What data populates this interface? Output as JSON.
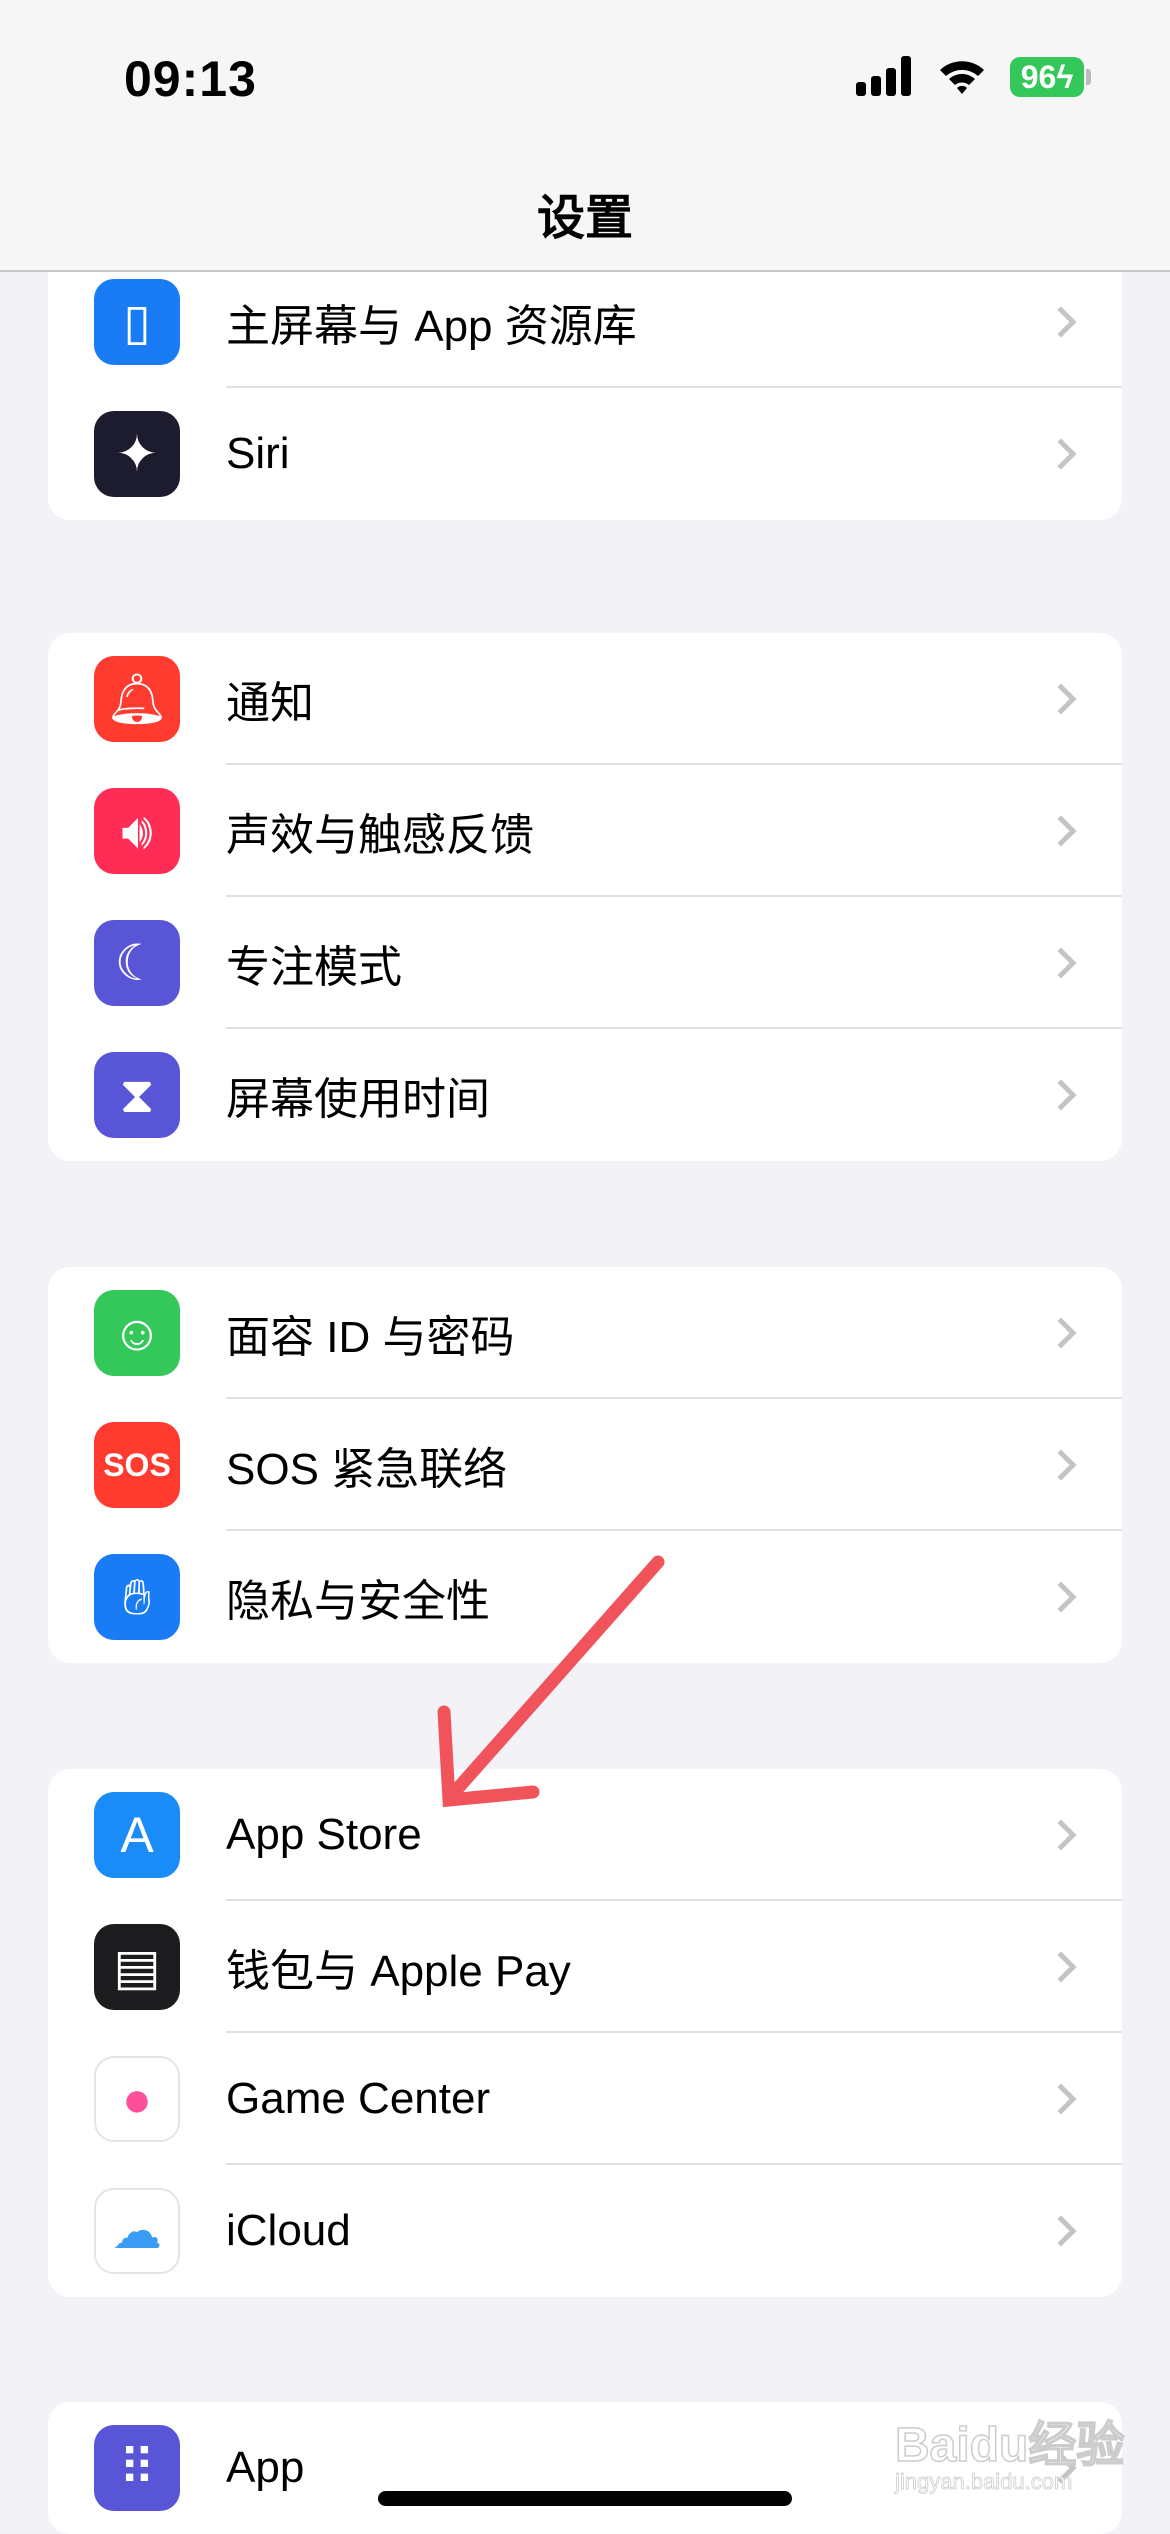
{
  "status_bar": {
    "time": "09:13",
    "battery": "96",
    "charging": true,
    "battery_color": "#34c759"
  },
  "header": {
    "title": "设置"
  },
  "groups": [
    {
      "items": [
        {
          "label": "主屏幕与 App 资源库",
          "icon": "home-screen-icon",
          "color": "#1a7cf5"
        },
        {
          "label": "Siri",
          "icon": "siri-icon",
          "color": "#1c1c2e"
        }
      ]
    },
    {
      "items": [
        {
          "label": "通知",
          "icon": "bell-icon",
          "color": "#ff3b30"
        },
        {
          "label": "声效与触感反馈",
          "icon": "speaker-icon",
          "color": "#ff2d55"
        },
        {
          "label": "专注模式",
          "icon": "moon-icon",
          "color": "#5856d6"
        },
        {
          "label": "屏幕使用时间",
          "icon": "hourglass-icon",
          "color": "#5856d6"
        }
      ]
    },
    {
      "items": [
        {
          "label": "面容 ID 与密码",
          "icon": "face-id-icon",
          "color": "#34c759"
        },
        {
          "label": "SOS 紧急联络",
          "icon": "sos-icon",
          "color": "#ff3b30",
          "icon_text": "SOS"
        },
        {
          "label": "隐私与安全性",
          "icon": "hand-icon",
          "color": "#1a7cf5"
        }
      ]
    },
    {
      "items": [
        {
          "label": "App Store",
          "icon": "app-store-icon",
          "color": "#1a8cf7"
        },
        {
          "label": "钱包与 Apple Pay",
          "icon": "wallet-icon",
          "color": "#1c1c1e"
        },
        {
          "label": "Game Center",
          "icon": "game-center-icon",
          "color": "#ffffff"
        },
        {
          "label": "iCloud",
          "icon": "icloud-icon",
          "color": "#ffffff"
        }
      ]
    },
    {
      "items": [
        {
          "label": "App",
          "icon": "apps-grid-icon",
          "color": "#5856d6"
        }
      ]
    }
  ],
  "annotation": {
    "arrow_color": "#f0545a",
    "points_to": "App Store"
  },
  "watermark": {
    "brand": "Bai du 经验",
    "url": "jingyan.baidu.com"
  }
}
